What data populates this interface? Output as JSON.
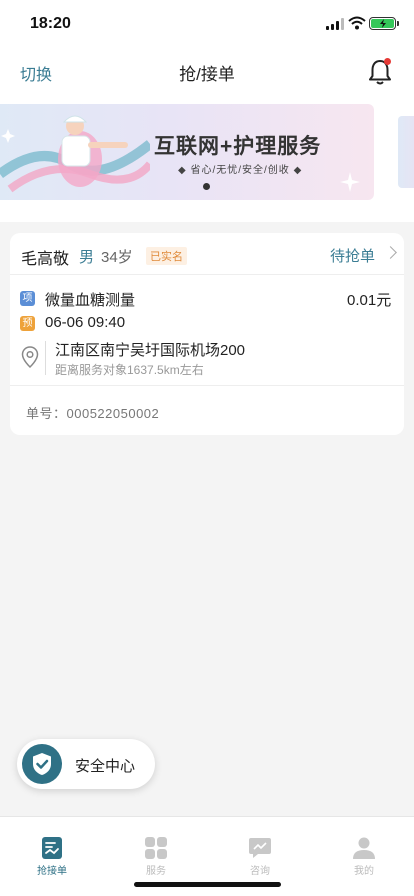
{
  "status_bar": {
    "time": "18:20"
  },
  "nav": {
    "left_label": "切换",
    "title": "抢/接单"
  },
  "banner": {
    "title": "互联网+护理服务",
    "subtitle": "◆ 省心/无忧/安全/创收 ◆"
  },
  "order": {
    "customer_name": "毛高敬",
    "gender": "男",
    "age": "34岁",
    "verified_badge": "已实名",
    "status": "待抢单",
    "item_tag": "项",
    "service_name": "微量血糖测量",
    "price": "0.01元",
    "time_tag": "预",
    "appointment_time": "06-06 09:40",
    "address": "江南区南宁吴圩国际机场200",
    "distance": "距离服务对象1637.5km左右",
    "order_number": "单号：000522050002"
  },
  "safety": {
    "label": "安全中心"
  },
  "tabs": [
    {
      "label": "抢接单",
      "icon": "order-grab-icon",
      "active": true
    },
    {
      "label": "服务",
      "icon": "grid-icon",
      "active": false
    },
    {
      "label": "咨询",
      "icon": "chat-icon",
      "active": false
    },
    {
      "label": "我的",
      "icon": "person-icon",
      "active": false
    }
  ],
  "colors": {
    "accent": "#3b7d94",
    "tab_active": "#2f7186",
    "badge_orange": "#e08a3a"
  }
}
